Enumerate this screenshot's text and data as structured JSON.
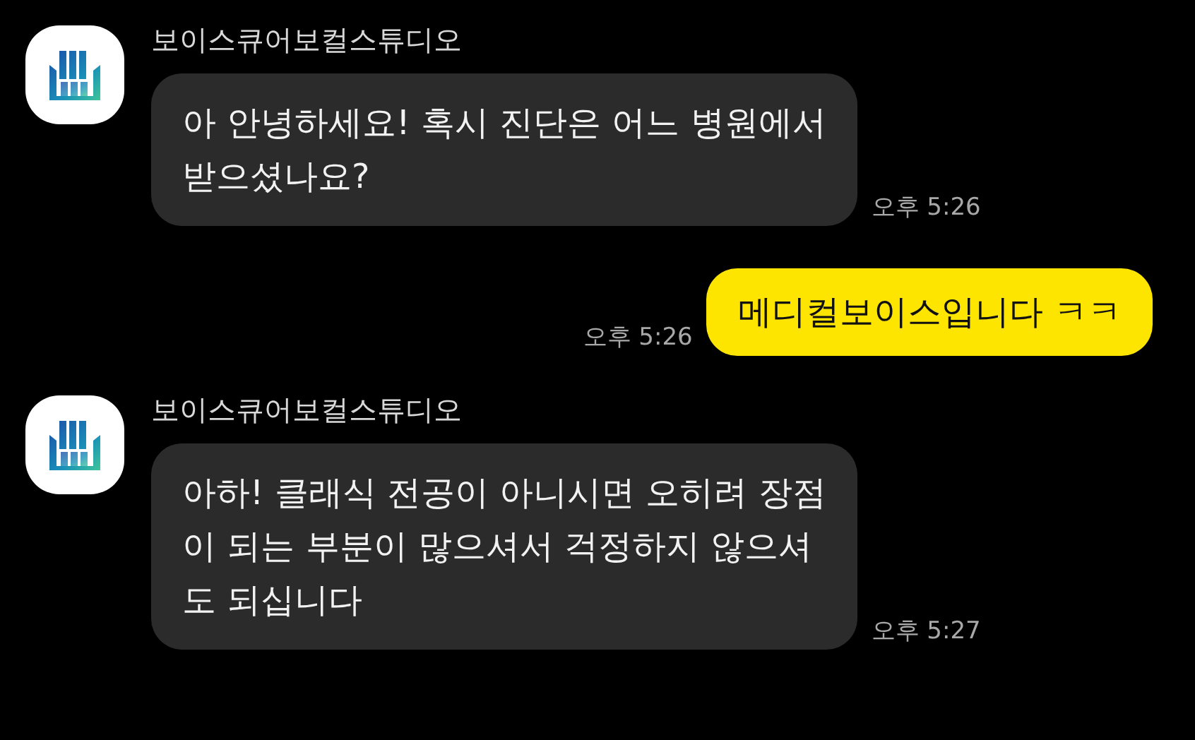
{
  "messages": [
    {
      "kind": "received",
      "sender": "보이스큐어보컬스튜디오",
      "lines": [
        "아 안녕하세요! 혹시 진단은 어느 병원에서",
        "받으셨나요?"
      ],
      "time": "오후 5:26"
    },
    {
      "kind": "sent",
      "lines": [
        "메디컬보이스입니다 ㅋㅋ"
      ],
      "time": "오후 5:26"
    },
    {
      "kind": "received",
      "sender": "보이스큐어보컬스튜디오",
      "lines": [
        "아하! 클래식 전공이 아니시면 오히려 장점",
        "이 되는 부분이 많으셔서 걱정하지 않으셔",
        "도 되십니다"
      ],
      "time": "오후 5:27"
    }
  ]
}
